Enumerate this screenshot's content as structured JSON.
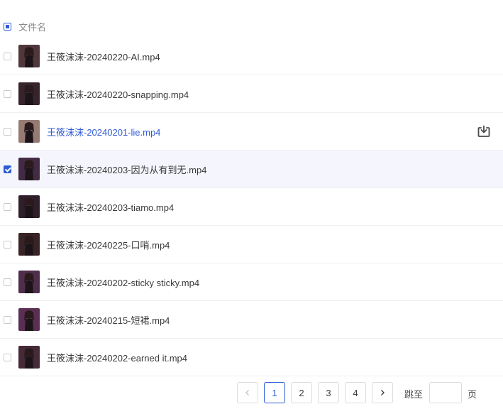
{
  "header": {
    "column_label": "文件名",
    "select_all_state": "indeterminate"
  },
  "files": [
    {
      "name": "王筱沫沫-20240220-AI.mp4",
      "checked": false,
      "hover": false,
      "thumb_tone": "#6b4a50"
    },
    {
      "name": "王筱沫沫-20240220-snapping.mp4",
      "checked": false,
      "hover": false,
      "thumb_tone": "#4a2f3a"
    },
    {
      "name": "王筱沫沫-20240201-lie.mp4",
      "checked": false,
      "hover": true,
      "thumb_tone": "#c9a49a"
    },
    {
      "name": "王筱沫沫-20240203-因为从有到无.mp4",
      "checked": true,
      "hover": false,
      "thumb_tone": "#5a3a5c"
    },
    {
      "name": "王筱沫沫-20240203-tiamo.mp4",
      "checked": false,
      "hover": false,
      "thumb_tone": "#3f2a3a"
    },
    {
      "name": "王筱沫沫-20240225-口哨.mp4",
      "checked": false,
      "hover": false,
      "thumb_tone": "#4b3033"
    },
    {
      "name": "王筱沫沫-20240202-sticky sticky.mp4",
      "checked": false,
      "hover": false,
      "thumb_tone": "#6a3e66"
    },
    {
      "name": "王筱沫沫-20240215-短裙.mp4",
      "checked": false,
      "hover": false,
      "thumb_tone": "#7a3e70"
    },
    {
      "name": "王筱沫沫-20240202-earned it.mp4",
      "checked": false,
      "hover": false,
      "thumb_tone": "#5c3a4a"
    }
  ],
  "row_action_icon": "download-icon",
  "pagination": {
    "prev_icon": "chevron-left-icon",
    "next_icon": "chevron-right-icon",
    "pages": [
      "1",
      "2",
      "3",
      "4"
    ],
    "current_page": "1",
    "jump_label": "跳至",
    "page_suffix": "页",
    "jump_value": ""
  },
  "colors": {
    "accent": "#2f5bd6",
    "selected_row_bg": "#f5f6fd"
  }
}
